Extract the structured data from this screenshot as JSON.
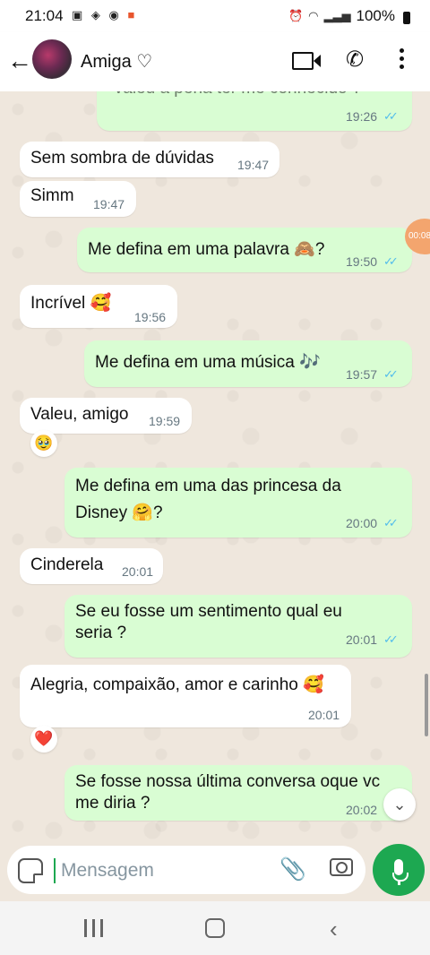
{
  "status_bar": {
    "time": "21:04",
    "battery": "100%"
  },
  "header": {
    "contact_name": "Amiga ♡"
  },
  "messages": [
    {
      "dir": "out",
      "text": "Valeu a pena ter me conhecido ?",
      "time": "19:26",
      "read": true
    },
    {
      "dir": "in",
      "text": "Sem sombra de dúvidas",
      "time": "19:47"
    },
    {
      "dir": "in",
      "text": "Simm",
      "time": "19:47"
    },
    {
      "dir": "out",
      "text": "Me defina em uma palavra 🙈?",
      "time": "19:50",
      "read": true
    },
    {
      "dir": "in",
      "text": "Incrível 🥰",
      "time": "19:56"
    },
    {
      "dir": "out",
      "text": "Me defina em uma música 🎶",
      "time": "19:57",
      "read": true
    },
    {
      "dir": "in",
      "text": "Valeu, amigo",
      "time": "19:59",
      "reaction": "🥹"
    },
    {
      "dir": "out",
      "text_line1": "Me defina em uma das princesa da",
      "text_line2": "Disney 🤗?",
      "time": "20:00",
      "read": true
    },
    {
      "dir": "in",
      "text": "Cinderela",
      "time": "20:01"
    },
    {
      "dir": "out",
      "text_line1": "Se eu fosse um sentimento qual eu",
      "text_line2": "seria ?",
      "time": "20:01",
      "read": true
    },
    {
      "dir": "in",
      "text": "Alegria, compaixão, amor e carinho 🥰",
      "time": "20:01",
      "reaction": "❤️"
    },
    {
      "dir": "out",
      "text_line1": "Se fosse nossa última conversa oque vc",
      "text_line2": "me diria ?",
      "time": "20:02",
      "read": true
    }
  ],
  "side_badge": "00:08",
  "composer": {
    "placeholder": "Mensagem"
  },
  "icons": {
    "back": "arrow-left",
    "video_call": "video-camera",
    "voice_call": "phone",
    "menu": "vertical-dots",
    "sticker": "sticker",
    "attach": "paperclip",
    "camera": "camera",
    "mic": "microphone",
    "scroll_down": "double-chevron-down"
  },
  "colors": {
    "outgoing_bubble": "#d9fdd3",
    "incoming_bubble": "#ffffff",
    "read_ticks": "#53bdeb",
    "mic_button": "#1da851",
    "chat_background": "#efe7dd"
  }
}
